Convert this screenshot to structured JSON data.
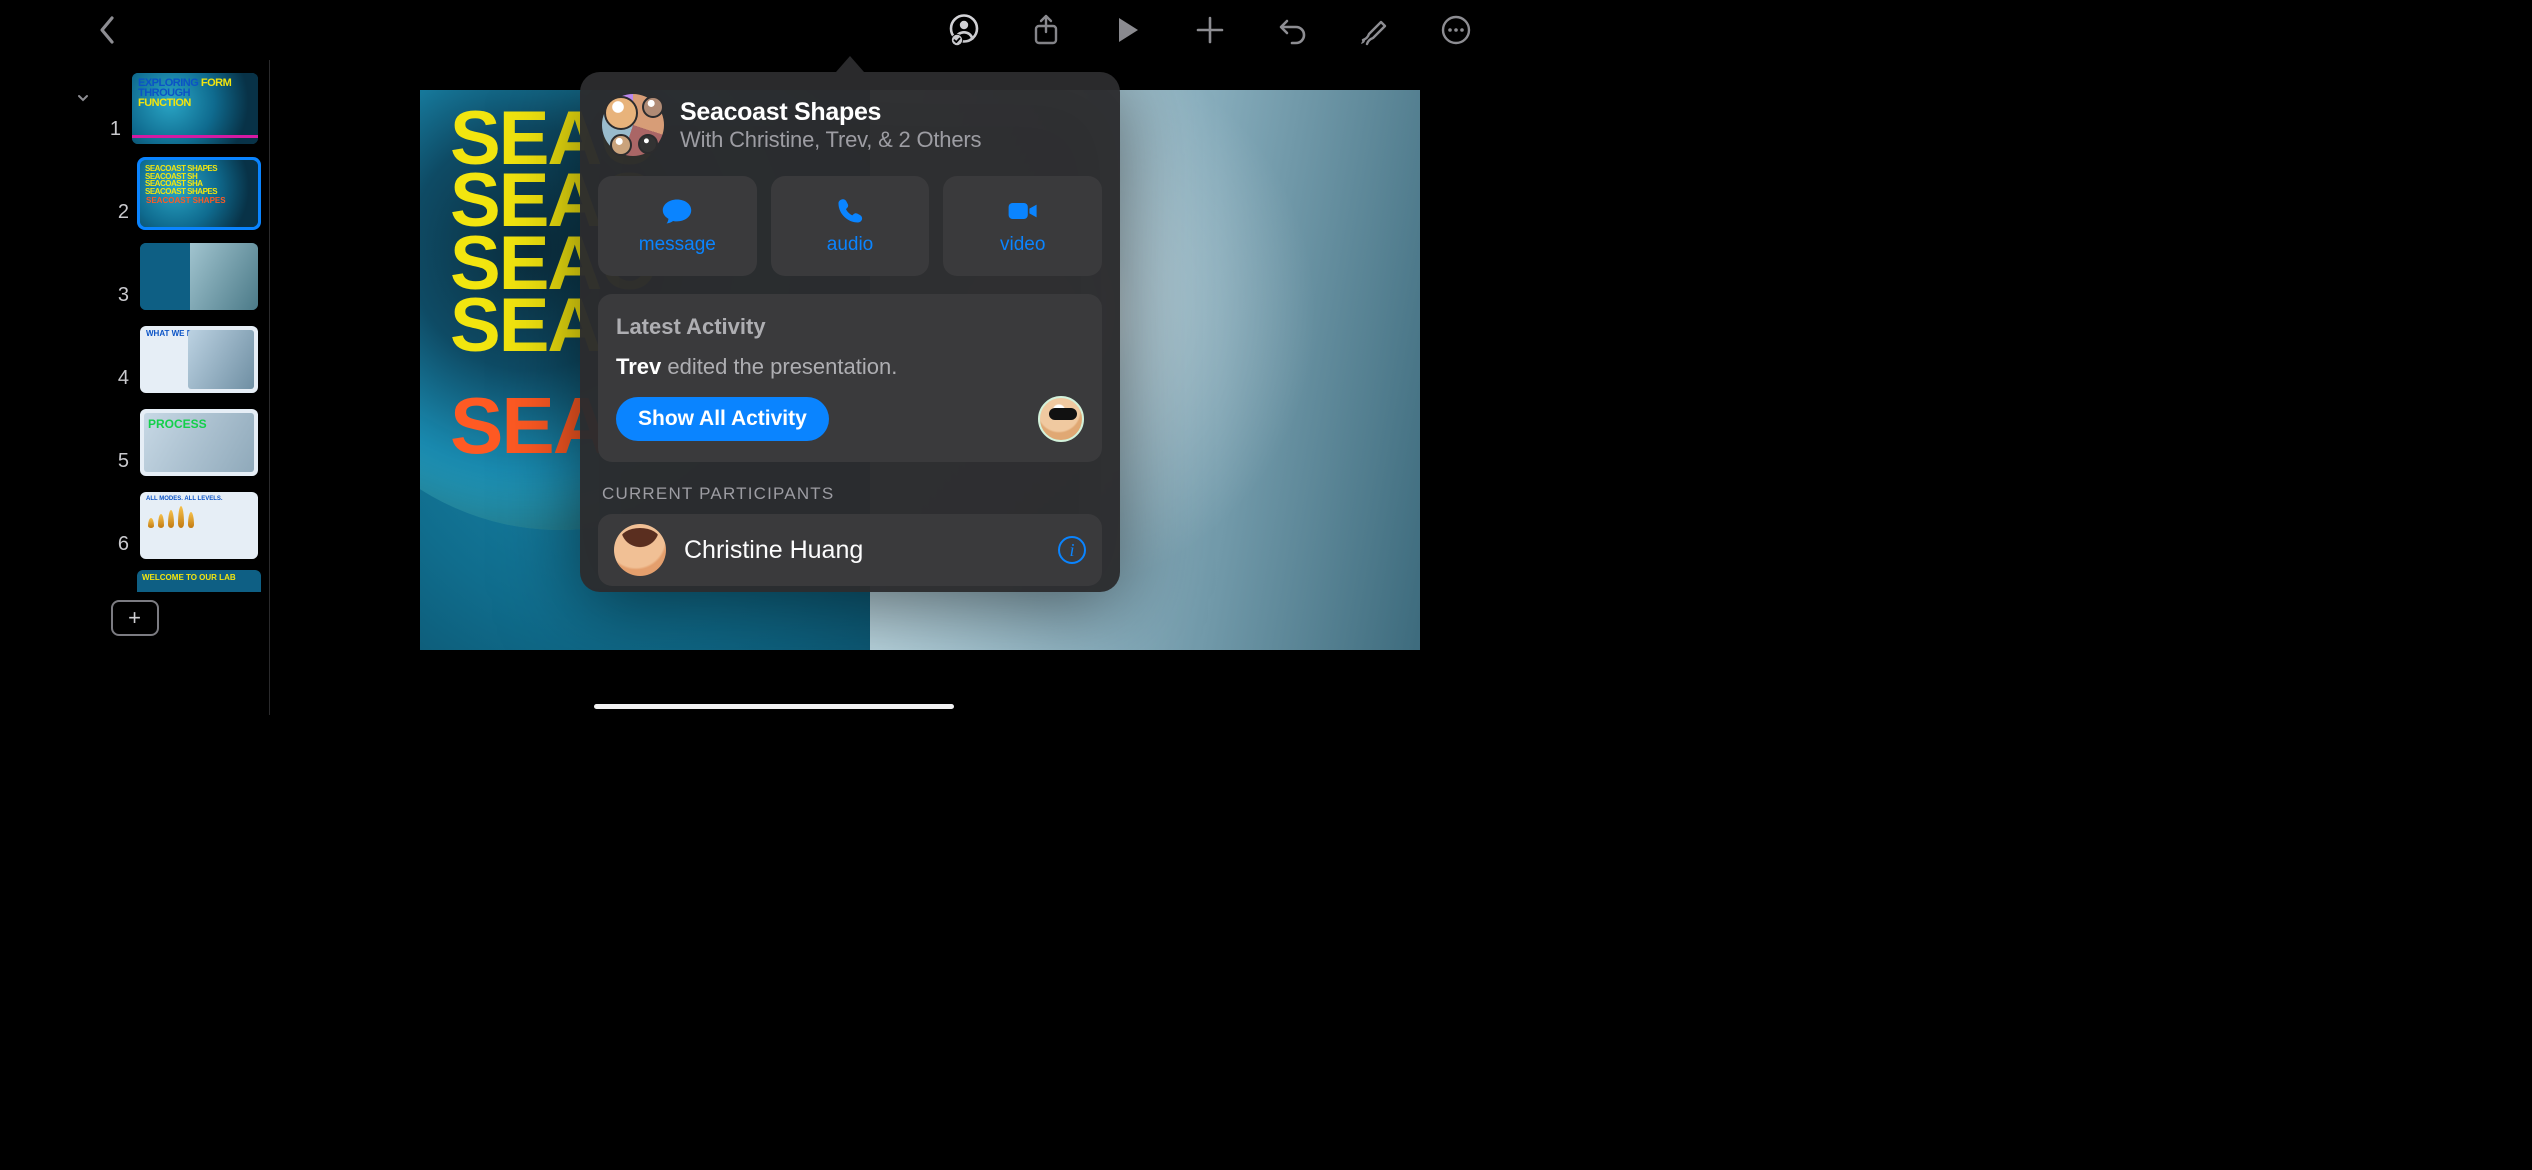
{
  "toolbar": {
    "icons": {
      "back": "chevron-left",
      "collab": "person-circle-check",
      "share": "square-arrow-up",
      "play": "play",
      "add": "plus",
      "undo": "arrow-uturn-left",
      "format": "paintbrush",
      "more": "ellipsis-circle"
    }
  },
  "slides": [
    {
      "n": "1",
      "title_lines": [
        "EXPLORING",
        "FORM",
        "THROUGH",
        "FUNCTION"
      ],
      "variant": "cover"
    },
    {
      "n": "2",
      "title_lines": [
        "SEACOAST SHAPES",
        "SEACOAST SH",
        "SEACOAST SHA",
        "SEACOAST SHAPES"
      ],
      "accent": "SEACOAST SHAPES",
      "variant": "title",
      "selected": true
    },
    {
      "n": "3",
      "variant": "photo-split"
    },
    {
      "n": "4",
      "heading": "WHAT WE DO",
      "variant": "two-col"
    },
    {
      "n": "5",
      "heading": "PROCESS",
      "variant": "process"
    },
    {
      "n": "6",
      "heading": "ALL MODES. ALL LEVELS.",
      "variant": "bars"
    }
  ],
  "peek_slide_text": "WELCOME TO OUR LAB",
  "add_slide_label": "+",
  "canvas": {
    "rows": [
      "SEAC",
      "SEAC",
      "SEAC",
      "SEAC"
    ],
    "accent_row": "SEAC"
  },
  "collab": {
    "title": "Seacoast Shapes",
    "subtitle": "With Christine, Trev, & 2 Others",
    "actions": {
      "message": "message",
      "audio": "audio",
      "video": "video"
    },
    "latest_activity": {
      "title": "Latest Activity",
      "actor": "Trev",
      "rest": " edited the presentation.",
      "show_all": "Show All Activity"
    },
    "participants_heading": "CURRENT PARTICIPANTS",
    "participants": [
      {
        "name": "Christine Huang"
      }
    ]
  }
}
